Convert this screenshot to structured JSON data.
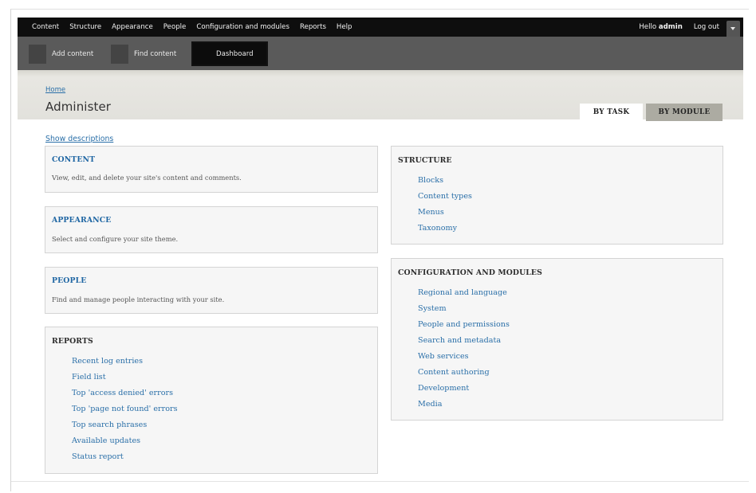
{
  "toolbar": {
    "menu": [
      "Content",
      "Structure",
      "Appearance",
      "People",
      "Configuration and modules",
      "Reports",
      "Help"
    ],
    "hello_prefix": "Hello ",
    "username": "admin",
    "logout": "Log out"
  },
  "shortcuts": {
    "items": [
      "Add content",
      "Find content",
      "Dashboard"
    ]
  },
  "header": {
    "breadcrumb": "Home",
    "title": "Administer",
    "tab_task": "BY TASK",
    "tab_module": "BY MODULE"
  },
  "show_descriptions": "Show descriptions",
  "panels": {
    "content": {
      "title": "CONTENT",
      "desc": "View, edit, and delete your site's content and comments."
    },
    "appearance": {
      "title": "APPEARANCE",
      "desc": "Select and configure your site theme."
    },
    "people": {
      "title": "PEOPLE",
      "desc": "Find and manage people interacting with your site."
    },
    "reports": {
      "title": "REPORTS",
      "links": [
        "Recent log entries",
        "Field list",
        "Top 'access denied' errors",
        "Top 'page not found' errors",
        "Top search phrases",
        "Available updates",
        "Status report"
      ]
    },
    "structure": {
      "title": "STRUCTURE",
      "links": [
        "Blocks",
        "Content types",
        "Menus",
        "Taxonomy"
      ]
    },
    "config": {
      "title": "CONFIGURATION AND MODULES",
      "links": [
        "Regional and language",
        "System",
        "People and permissions",
        "Search and metadata",
        "Web services",
        "Content authoring",
        "Development",
        "Media"
      ]
    }
  }
}
